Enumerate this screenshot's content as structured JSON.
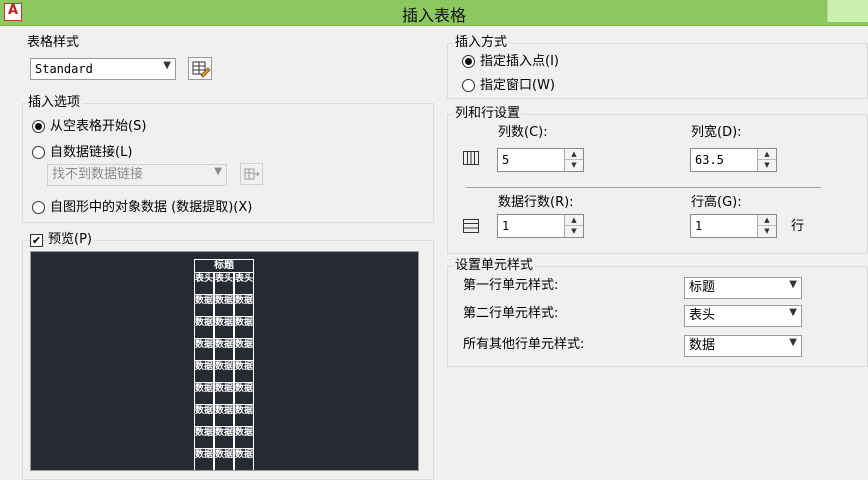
{
  "window": {
    "title": "插入表格"
  },
  "table_style": {
    "group_label": "表格样式",
    "selected": "Standard"
  },
  "insert_options": {
    "group_label": "插入选项",
    "radio_empty": "从空表格开始(S)",
    "radio_datalink": "自数据链接(L)",
    "datalink_placeholder": "找不到数据链接",
    "radio_extract": "自图形中的对象数据 (数据提取)(X)"
  },
  "preview": {
    "label": "预览(P)",
    "checked": true,
    "title_cell": "标题",
    "header_cell": "表头",
    "data_cell": "数据",
    "data_rows": 9
  },
  "insert_method": {
    "group_label": "插入方式",
    "radio_point": "指定插入点(I)",
    "radio_window": "指定窗口(W)"
  },
  "row_col": {
    "group_label": "列和行设置",
    "columns_label": "列数(C):",
    "columns_value": "5",
    "col_width_label": "列宽(D):",
    "col_width_value": "63.5",
    "data_rows_label": "数据行数(R):",
    "data_rows_value": "1",
    "row_height_label": "行高(G):",
    "row_height_value": "1",
    "row_unit": "行"
  },
  "cell_styles": {
    "group_label": "设置单元样式",
    "first_row_label": "第一行单元样式:",
    "first_row_value": "标题",
    "second_row_label": "第二行单元样式:",
    "second_row_value": "表头",
    "other_rows_label": "所有其他行单元样式:",
    "other_rows_value": "数据"
  }
}
